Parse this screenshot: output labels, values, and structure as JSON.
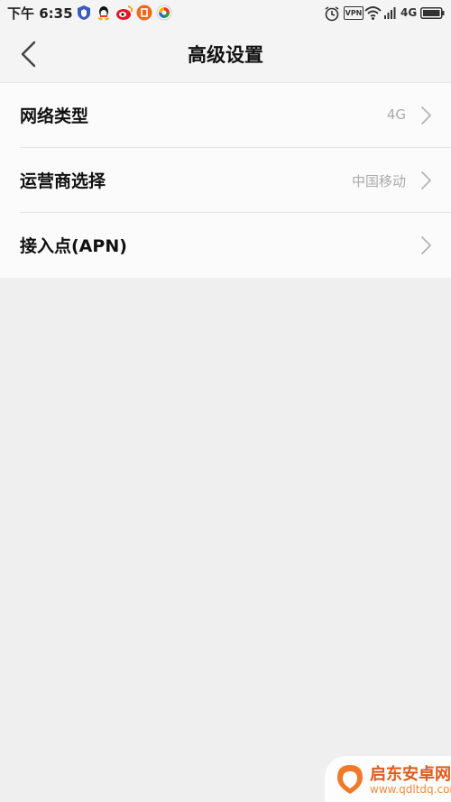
{
  "status_bar": {
    "time": "下午 6:35",
    "network": "4G",
    "vpn": "VPN"
  },
  "header": {
    "title": "高级设置"
  },
  "settings": [
    {
      "label": "网络类型",
      "value": "4G"
    },
    {
      "label": "运营商选择",
      "value": "中国移动"
    },
    {
      "label": "接入点(APN)",
      "value": ""
    }
  ],
  "watermark": {
    "name": "启东安卓网",
    "url": "www.qdltdq.com"
  },
  "colors": {
    "background": "#efefef",
    "list_bg": "#fbfbfb",
    "secondary_text": "#aaaaaa",
    "watermark_orange": "#e05a1a"
  },
  "icons": [
    "shield-icon",
    "qq-icon",
    "weibo-icon",
    "app-icon",
    "browser-icon",
    "alarm-icon",
    "wifi-icon",
    "signal-icon",
    "battery-icon",
    "back-arrow-icon",
    "chevron-right-icon"
  ]
}
